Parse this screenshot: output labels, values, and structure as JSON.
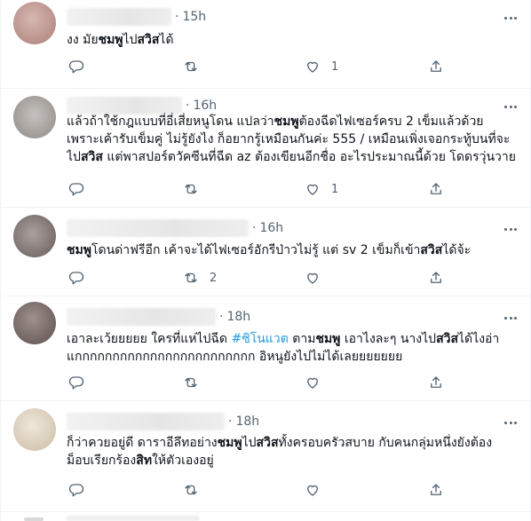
{
  "tweets": [
    {
      "time": "15h",
      "separator": "·",
      "text_parts": [
        "งง มัย",
        "ชมพู",
        "ไป",
        "สวิส",
        "ได้"
      ],
      "reply_count": "",
      "retweet_count": "",
      "like_count": "1",
      "avatar_color": "#c9a6a1"
    },
    {
      "time": "16h",
      "separator": "·",
      "lines": [
        [
          "แล้วถ้าใช้กฎแบบที่อี่เสี่ยหนูโดน แปลว่า",
          "ชมพู",
          "ต้องฉีดไฟเซอร์ครบ 2 เข็มแล้วด้วย"
        ],
        [
          "เพราะเค้ารับเข็มคู่ ไม่รู้ยังไง ก็อยากรู้เหมือนกันค่ะ 555 / เหมือนเพิ่งเจอกระทู้บนที่จะ"
        ],
        [
          "ไป",
          "สวิส",
          " แต่พาสปอร์ตวัคซีนที่ฉีด az ต้องเขียนอีกชื่อ อะไรประมาณนี้ด้วย โดดรวุ่นวาย"
        ]
      ],
      "reply_count": "",
      "retweet_count": "",
      "like_count": "1",
      "avatar_color": "#b6b3b0"
    },
    {
      "time": "16h",
      "separator": "·",
      "text_parts": [
        "ชมพู",
        "โดนด่าฟรีอีก เค้าจะได้ไฟเซอร์อักรีป่าวไม่รู้ แต่ sv 2 เข็มก็เข้า",
        "สวิส",
        "ได้จ้ะ"
      ],
      "reply_count": "",
      "retweet_count": "2",
      "like_count": "",
      "avatar_color": "#9a8f8e"
    },
    {
      "time": "18h",
      "separator": "·",
      "line1": [
        "เอาละเว้ยยยยย ใครที่แห่ไปฉีด ",
        "#ซิโนแวต",
        " ตาม",
        "ชมพู",
        " เอาไงละๆ นางไป",
        "สวิส",
        "ได้ไงอ่า"
      ],
      "line2": "แกกกกกกกกกกกกกกกกกกกกกกกก อิหนูยังไปไม่ได้เลยยยยยยย",
      "reply_count": "",
      "retweet_count": "",
      "like_count": "",
      "avatar_color": "#8b7f7c"
    },
    {
      "time": "18h",
      "separator": "·",
      "line1": [
        "ก็ว่าควยอยู่ดี ดาราอีลึทอย่าง",
        "ชมพู",
        "ไป",
        "สวิส",
        "ทั้งครอบครัวสบาย กับคนกลุ่มหนึ่งยังต้อง"
      ],
      "line2": [
        "ม็อบเรียกร้อง",
        "สิท",
        "ให้ตัวเองอยู่"
      ],
      "reply_count": "",
      "retweet_count": "",
      "like_count": "",
      "avatar_color": "#e3d9ca"
    }
  ]
}
